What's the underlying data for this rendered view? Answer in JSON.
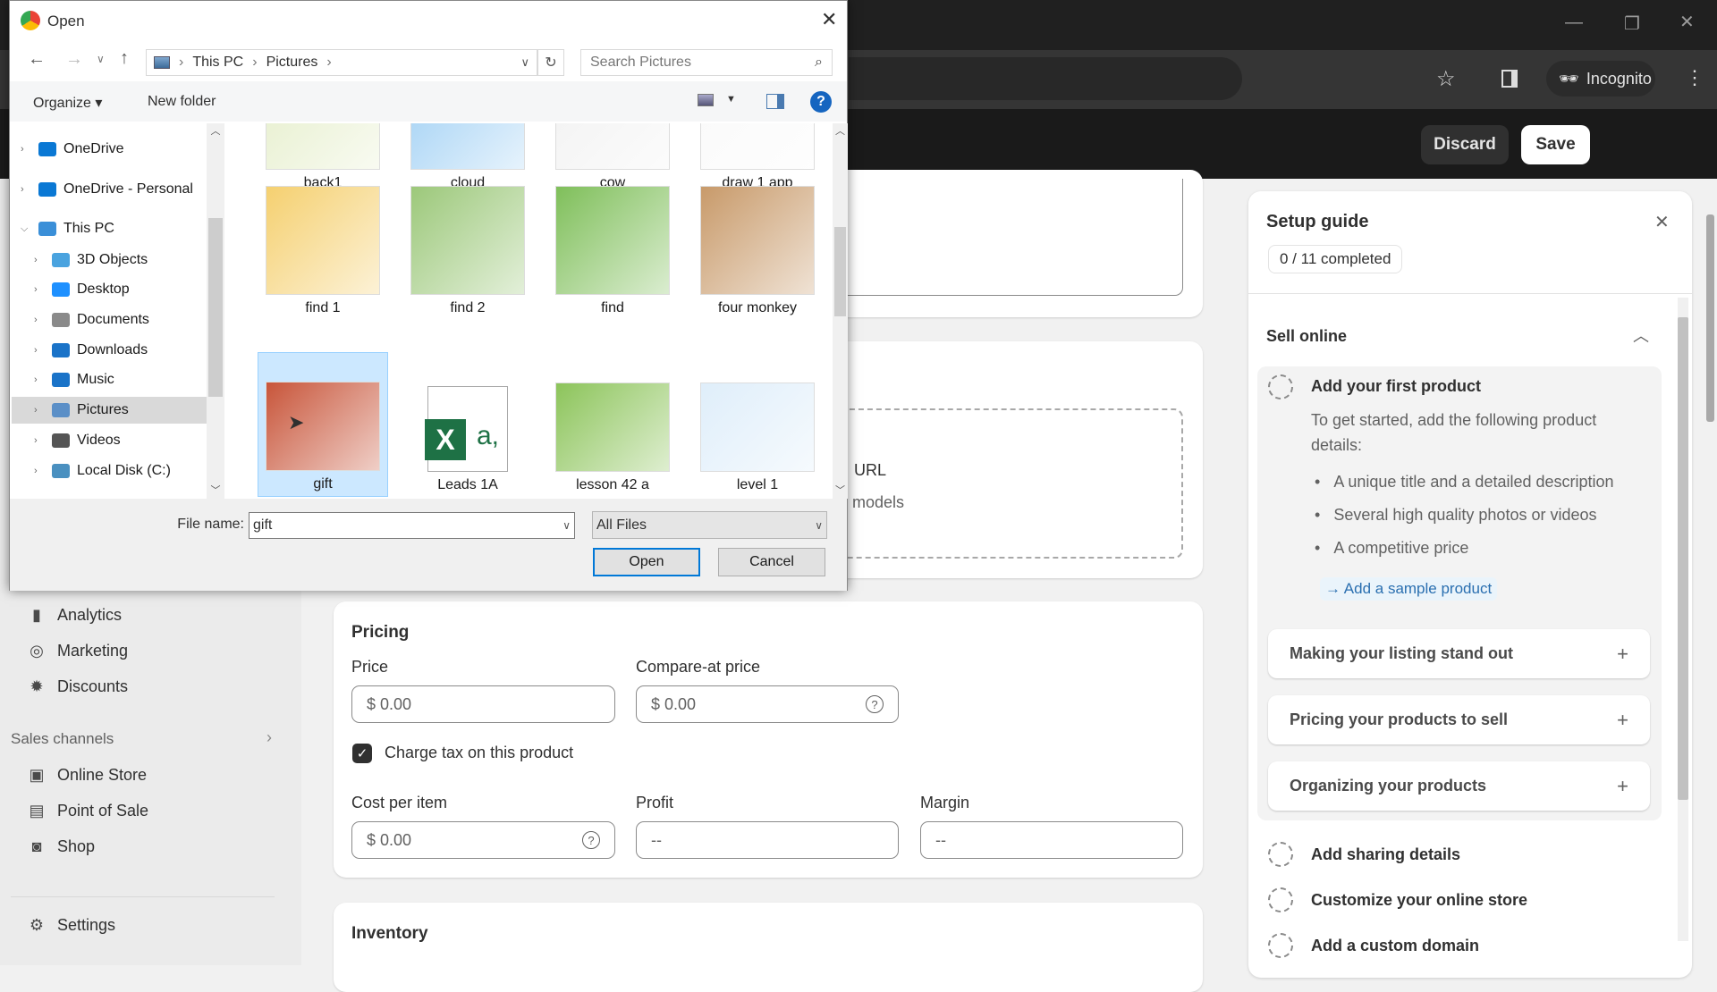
{
  "browser": {
    "incognito_label": "Incognito"
  },
  "app": {
    "discard": "Discard",
    "save": "Save",
    "sidebar": [
      {
        "label": "Analytics",
        "icon": "bar-chart-icon",
        "glyph": "▮"
      },
      {
        "label": "Marketing",
        "icon": "target-icon",
        "glyph": "◎"
      },
      {
        "label": "Discounts",
        "icon": "discount-icon",
        "glyph": "✹"
      }
    ],
    "sales_channels": "Sales channels",
    "channels": [
      {
        "label": "Online Store",
        "icon": "store-icon",
        "glyph": "▣"
      },
      {
        "label": "Point of Sale",
        "icon": "pos-icon",
        "glyph": "▤"
      },
      {
        "label": "Shop",
        "icon": "shop-icon",
        "glyph": "◙"
      }
    ],
    "settings": "Settings",
    "media": {
      "url_text": "URL",
      "models_text": "models"
    },
    "pricing": {
      "title": "Pricing",
      "price_label": "Price",
      "price_value": "$  0.00",
      "compare_label": "Compare-at price",
      "compare_value": "$  0.00",
      "charge_tax": "Charge tax on this product",
      "charge_tax_checked": true,
      "cost_label": "Cost per item",
      "cost_value": "$  0.00",
      "profit_label": "Profit",
      "profit_value": "--",
      "margin_label": "Margin",
      "margin_value": "--"
    },
    "inventory_title": "Inventory",
    "guide": {
      "title": "Setup guide",
      "progress": "0 / 11 completed",
      "section": "Sell online",
      "step1": "Add your first product",
      "step1_desc": "To get started, add the following product details:",
      "bullets": [
        "A unique title and a detailed description",
        "Several high quality photos or videos",
        "A competitive price"
      ],
      "sample_link": "Add a sample product",
      "accordions": [
        "Making your listing stand out",
        "Pricing your products to sell",
        "Organizing your products"
      ],
      "steps": [
        "Add sharing details",
        "Customize your online store",
        "Add a custom domain"
      ]
    }
  },
  "dialog": {
    "title": "Open",
    "breadcrumb": [
      "This PC",
      "Pictures"
    ],
    "search_placeholder": "Search Pictures",
    "organize": "Organize",
    "new_folder": "New folder",
    "nav": [
      {
        "label": "OneDrive",
        "level": 0,
        "icon": "cloud-icon",
        "color": "#0a78d4",
        "expanded": false
      },
      {
        "label": "OneDrive - Personal",
        "level": 0,
        "icon": "cloud-icon",
        "color": "#0a78d4",
        "expanded": false
      },
      {
        "label": "This PC",
        "level": 0,
        "icon": "computer-icon",
        "color": "#3a8fd8",
        "expanded": true
      },
      {
        "label": "3D Objects",
        "level": 1,
        "icon": "cube-icon",
        "color": "#4aa3df"
      },
      {
        "label": "Desktop",
        "level": 1,
        "icon": "desktop-icon",
        "color": "#1e90ff"
      },
      {
        "label": "Documents",
        "level": 1,
        "icon": "document-icon",
        "color": "#8a8a8a"
      },
      {
        "label": "Downloads",
        "level": 1,
        "icon": "download-icon",
        "color": "#1a73c8"
      },
      {
        "label": "Music",
        "level": 1,
        "icon": "music-icon",
        "color": "#1a73c8"
      },
      {
        "label": "Pictures",
        "level": 1,
        "icon": "pictures-icon",
        "color": "#5b8fc7",
        "selected": true
      },
      {
        "label": "Videos",
        "level": 1,
        "icon": "video-icon",
        "color": "#555"
      },
      {
        "label": "Local Disk (C:)",
        "level": 1,
        "icon": "drive-icon",
        "color": "#4a90c0"
      }
    ],
    "files": [
      {
        "name": "back1",
        "c": "#e8f0d0"
      },
      {
        "name": "cloud",
        "c": "#a8d4f5"
      },
      {
        "name": "cow",
        "c": "#f3f3f3"
      },
      {
        "name": "draw 1 app",
        "c": "#fafafa"
      },
      {
        "name": "find 1",
        "c": "#f5d070"
      },
      {
        "name": "find 2",
        "c": "#9cc87a"
      },
      {
        "name": "find",
        "c": "#7fbf5a"
      },
      {
        "name": "four monkey",
        "c": "#c89a6a"
      },
      {
        "name": "gift",
        "c": "#c8553a",
        "selected": true
      },
      {
        "name": "Leads 1A",
        "c": "#ffffff",
        "excel": true
      },
      {
        "name": "lesson 42 a",
        "c": "#8cc45a"
      },
      {
        "name": "level 1",
        "c": "#dfeefa"
      }
    ],
    "file_name_label": "File name:",
    "file_name": "gift",
    "filter": "All Files",
    "open": "Open",
    "cancel": "Cancel"
  }
}
